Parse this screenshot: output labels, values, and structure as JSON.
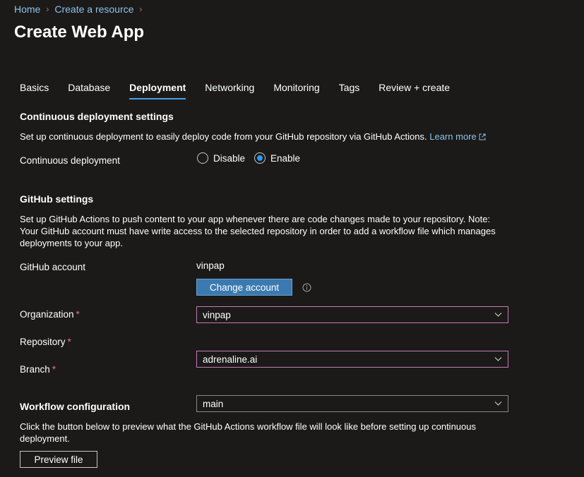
{
  "breadcrumb": {
    "home": "Home",
    "create_resource": "Create a resource"
  },
  "page": {
    "title": "Create Web App"
  },
  "tabs": [
    {
      "label": "Basics"
    },
    {
      "label": "Database"
    },
    {
      "label": "Deployment",
      "active": true
    },
    {
      "label": "Networking"
    },
    {
      "label": "Monitoring"
    },
    {
      "label": "Tags"
    },
    {
      "label": "Review + create"
    }
  ],
  "cd": {
    "heading": "Continuous deployment settings",
    "description": "Set up continuous deployment to easily deploy code from your GitHub repository via GitHub Actions.",
    "learn_more": "Learn more",
    "label": "Continuous deployment",
    "options": {
      "disable": "Disable",
      "enable": "Enable"
    },
    "selected": "Enable"
  },
  "github": {
    "heading": "GitHub settings",
    "description": "Set up GitHub Actions to push content to your app whenever there are code changes made to your repository. Note: Your GitHub account must have write access to the selected repository in order to add a workflow file which manages deployments to your app.",
    "account_label": "GitHub account",
    "account_value": "vinpap",
    "change_account": "Change account",
    "org_label": "Organization",
    "org_value": "vinpap",
    "repo_label": "Repository",
    "repo_value": "adrenaline.ai",
    "branch_label": "Branch",
    "branch_value": "main",
    "required_mark": "*"
  },
  "workflow": {
    "heading": "Workflow configuration",
    "description": "Click the button below to preview what the GitHub Actions workflow file will look like before setting up continuous deployment.",
    "preview_button": "Preview file"
  },
  "colors": {
    "accent": "#4aa0e6",
    "link": "#8ec3ea",
    "primary_button": "#3b7ab0",
    "required": "#f1707b",
    "background": "#1b1a19"
  },
  "icons": {
    "external_link": "external-link-icon",
    "info": "info-icon",
    "chevron": "chevron-down-icon",
    "breadcrumb_sep": "chevron-right-icon"
  }
}
